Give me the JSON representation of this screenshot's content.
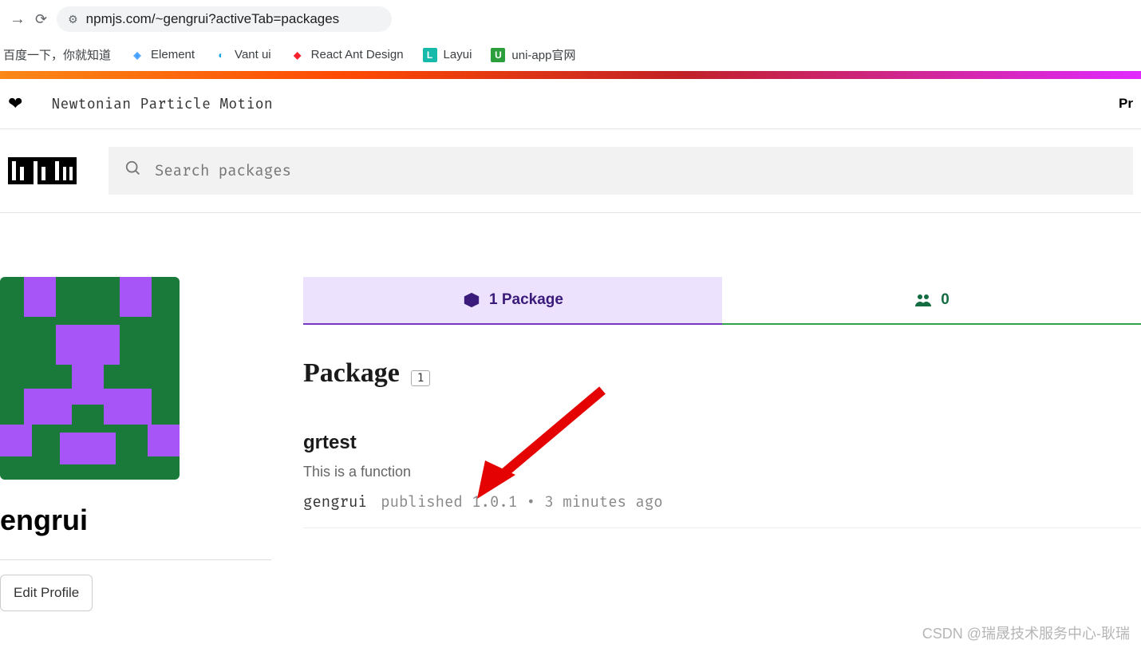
{
  "browser": {
    "url": "npmjs.com/~gengrui?activeTab=packages"
  },
  "bookmarks": [
    {
      "label": "百度一下，你就知道"
    },
    {
      "label": "Element"
    },
    {
      "label": "Vant ui"
    },
    {
      "label": "React Ant Design"
    },
    {
      "label": "Layui"
    },
    {
      "label": "uni-app官网"
    }
  ],
  "header": {
    "tagline": "Newtonian Particle Motion",
    "right": "Pr"
  },
  "search": {
    "placeholder": "Search packages"
  },
  "profile": {
    "username": "engrui",
    "edit_label": "Edit Profile"
  },
  "tabs": {
    "packages_label": "1 Package",
    "orgs_count": "0"
  },
  "section": {
    "title": "Package",
    "count": "1"
  },
  "package": {
    "name": "grtest",
    "description": "This is a function",
    "author": "gengrui",
    "published_word": "published",
    "version": "1.0.1",
    "separator": "•",
    "time": "3 minutes ago"
  },
  "watermark": "CSDN @瑞晟技术服务中心-耿瑞"
}
